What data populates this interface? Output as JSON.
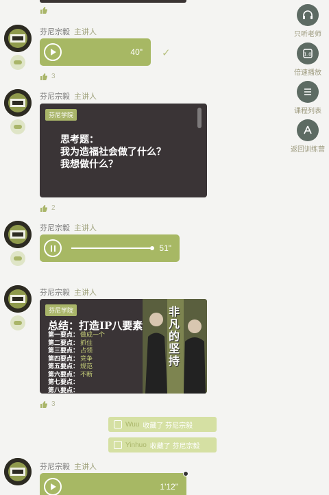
{
  "speaker": {
    "name": "芬尼宗毅",
    "role": "主讲人"
  },
  "messages": [
    {
      "type": "voice",
      "duration": "40\"",
      "likes": "3"
    },
    {
      "type": "image",
      "badge": "芬尼学院",
      "line1": "思考题：",
      "line2": "我为造福社会做了什么？",
      "line3": "我想做什么？",
      "likes": "2"
    },
    {
      "type": "voice",
      "duration": "51\"",
      "progress": 1.0
    },
    {
      "type": "image",
      "badge": "芬尼学院",
      "title": "总结：打造IP八要素",
      "points": [
        {
          "k": "第一要点：",
          "v": "做成一个"
        },
        {
          "k": "第二要点：",
          "v": "抓住"
        },
        {
          "k": "第三要点：",
          "v": "占领"
        },
        {
          "k": "第四要点：",
          "v": "竞争"
        },
        {
          "k": "第五要点：",
          "v": "规范"
        },
        {
          "k": "第六要点：",
          "v": "不断"
        },
        {
          "k": "第七要点：",
          "v": ""
        },
        {
          "k": "第八要点：",
          "v": ""
        }
      ],
      "cover_title": "非凡的坚持",
      "likes": "3"
    },
    {
      "type": "voice",
      "duration": "1'12\""
    }
  ],
  "notices": [
    {
      "who": "Wuu",
      "text": "收藏了 芬尼宗毅"
    },
    {
      "who": "Yinhuo",
      "text": "收藏了 芬尼宗毅"
    }
  ],
  "sidebar": [
    {
      "label": "只听老师",
      "icon": "headphones-icon"
    },
    {
      "label": "倍速播放",
      "icon": "speed-icon"
    },
    {
      "label": "课程列表",
      "icon": "list-icon"
    },
    {
      "label": "返回训练营",
      "icon": "back-icon"
    }
  ],
  "colors": {
    "accent": "#a7b864",
    "card": "#3a3436",
    "side": "#5d6b63"
  }
}
